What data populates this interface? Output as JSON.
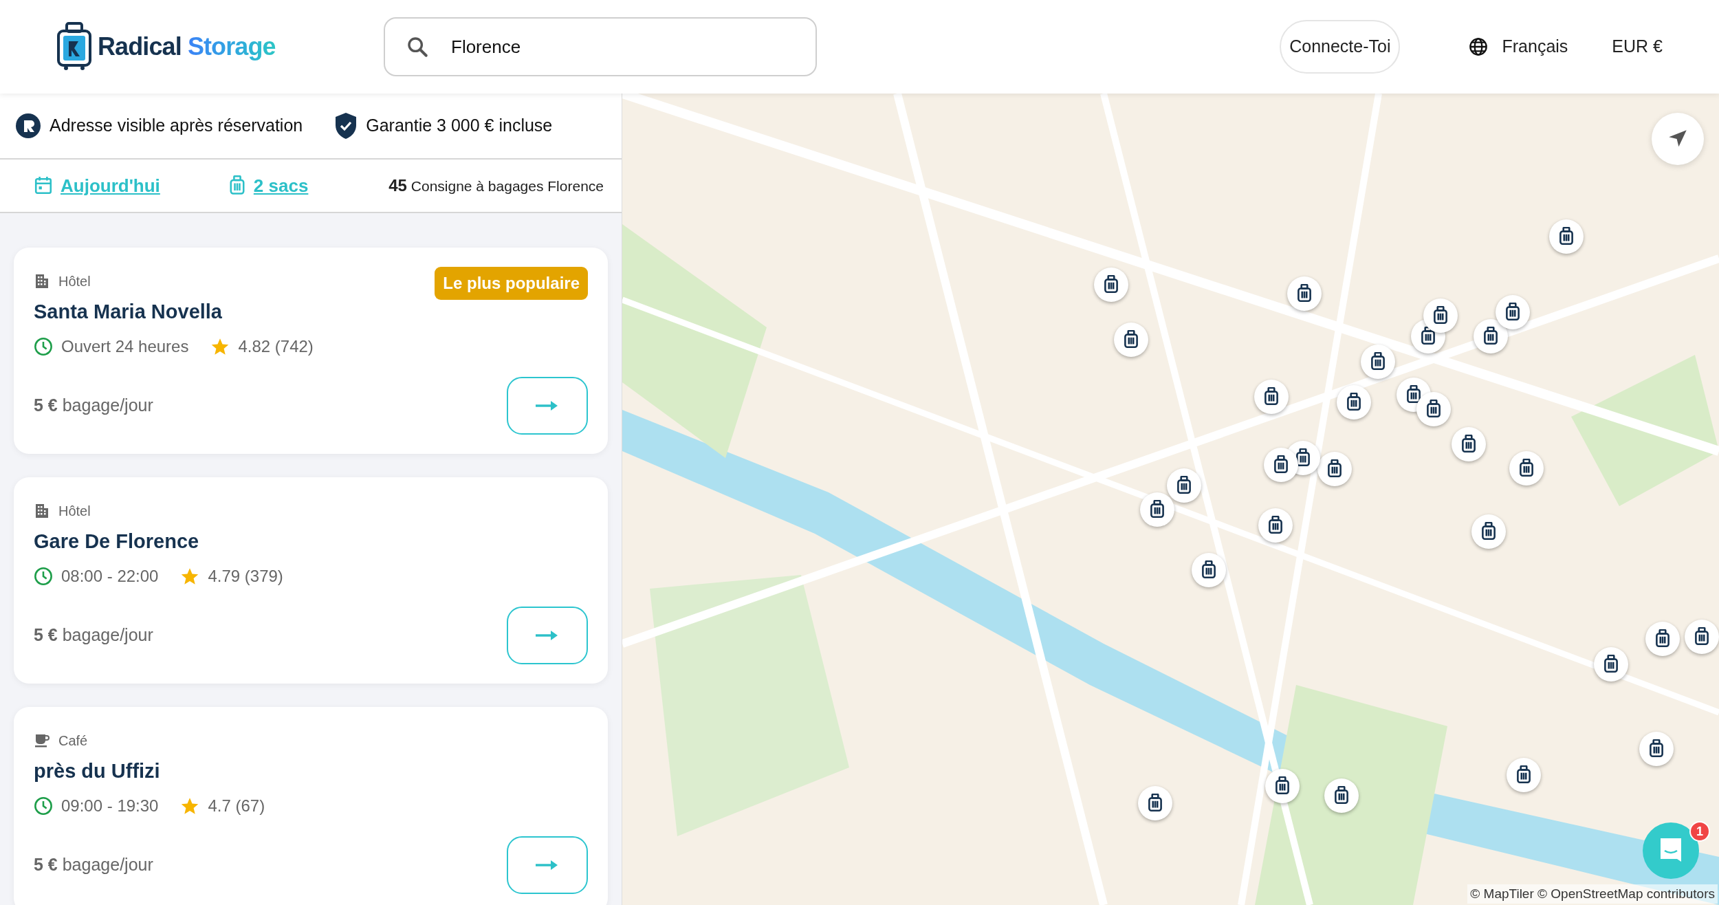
{
  "header": {
    "logo": {
      "word_1": "Radical",
      "word_2": "Storage"
    },
    "search": {
      "value": "Florence"
    },
    "login_button": "Connecte-Toi",
    "language": "Français",
    "currency": "EUR €"
  },
  "info": [
    {
      "kind": "address",
      "text": "Adresse visible après réservation"
    },
    {
      "kind": "guarantee",
      "text": "Garantie 3 000 € incluse"
    }
  ],
  "filters": {
    "date": "Aujourd'hui",
    "bags": "2 sacs",
    "count": "45",
    "count_label": "Consigne à bagages Florence"
  },
  "listings": [
    {
      "kind": "hotel",
      "category": "Hôtel",
      "badge": "Le plus populaire",
      "name": "Santa Maria Novella",
      "hours": "Ouvert 24 heures",
      "rating": "4.82 (742)",
      "price": "5 €",
      "price_unit": "bagage/jour"
    },
    {
      "kind": "hotel",
      "category": "Hôtel",
      "name": "Gare De Florence",
      "hours": "08:00 - 22:00",
      "rating": "4.79 (379)",
      "price": "5 €",
      "price_unit": "bagage/jour"
    },
    {
      "kind": "cafe",
      "category": "Café",
      "name": "près du Uffizi",
      "hours": "09:00 - 19:30",
      "rating": "4.7 (67)",
      "price": "5 €",
      "price_unit": "bagage/jour"
    }
  ],
  "map": {
    "kind": "picture",
    "attribution": "© MapTiler © OpenStreetMap contributors",
    "chat_badge": "1"
  }
}
